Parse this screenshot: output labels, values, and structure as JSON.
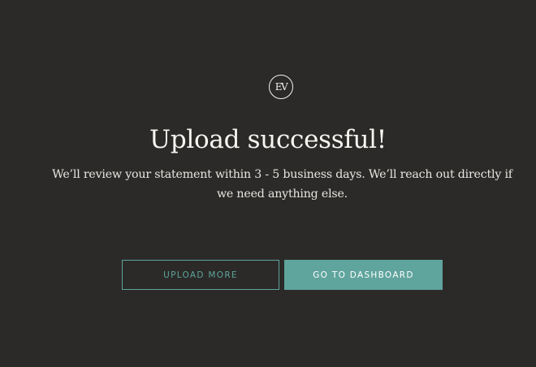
{
  "logo": {
    "text": "EV"
  },
  "heading": "Upload successful!",
  "message": "We’ll review your statement within 3 - 5 business days. We’ll reach out directly if we need anything else.",
  "actions": {
    "upload_more_label": "UPLOAD MORE",
    "dashboard_label": "GO TO DASHBOARD"
  },
  "colors": {
    "background": "#2b2a28",
    "accent": "#5fa49d",
    "text": "#f4f2ee"
  }
}
